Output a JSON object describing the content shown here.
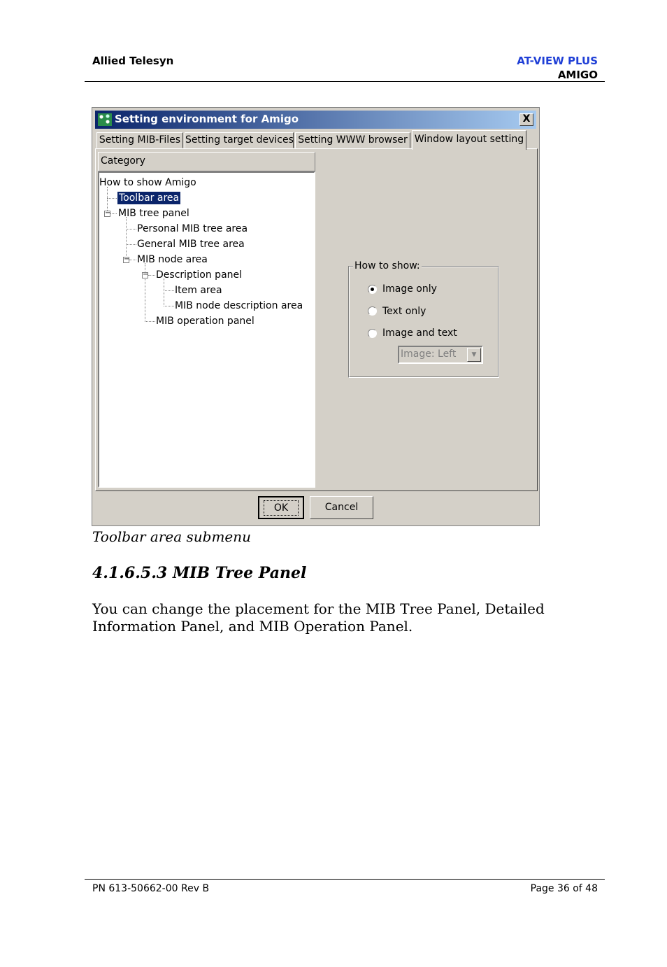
{
  "header": {
    "company": "Allied Telesyn",
    "product": "AT-VIEW PLUS",
    "module": "AMIGO"
  },
  "dialog": {
    "title": "Setting environment for Amigo",
    "close_label": "X",
    "tabs": [
      {
        "label": "Setting MIB-Files"
      },
      {
        "label": "Setting target devices"
      },
      {
        "label": "Setting WWW browser"
      },
      {
        "label": "Window layout setting",
        "active": true
      }
    ],
    "category_header": "Category",
    "tree": [
      {
        "label": "How to show Amigo"
      },
      {
        "label": "Toolbar area",
        "selected": true
      },
      {
        "label": "MIB tree panel"
      },
      {
        "label": "Personal MIB tree area"
      },
      {
        "label": "General MIB tree area"
      },
      {
        "label": "MIB node area"
      },
      {
        "label": "Description panel"
      },
      {
        "label": "Item area"
      },
      {
        "label": "MIB node description area"
      },
      {
        "label": "MIB operation panel"
      }
    ],
    "group": {
      "legend": "How to show:",
      "options": [
        {
          "label": "Image only",
          "selected": true
        },
        {
          "label": "Text only",
          "selected": false
        },
        {
          "label": "Image and text",
          "selected": false
        }
      ],
      "combo_value": "Image: Left"
    },
    "ok_label": "OK",
    "cancel_label": "Cancel"
  },
  "caption": "Toolbar area submenu",
  "section_heading": "4.1.6.5.3 MIB Tree Panel",
  "paragraph": "You can change the placement for the MIB Tree Panel, Detailed Information Panel, and MIB Operation Panel.",
  "footer": {
    "part_number": "PN 613-50662-00 Rev B",
    "page": "Page 36 of 48"
  }
}
